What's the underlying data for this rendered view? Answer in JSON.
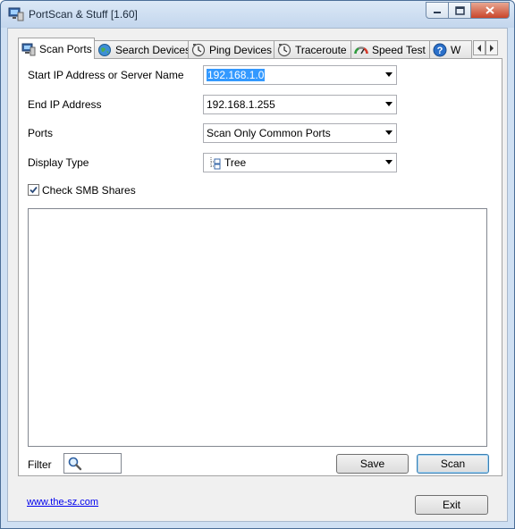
{
  "window": {
    "title": "PortScan & Stuff [1.60]"
  },
  "tabs": [
    {
      "label": "Scan Ports",
      "icon": "computer-icon",
      "active": true
    },
    {
      "label": "Search Devices",
      "icon": "globe-icon"
    },
    {
      "label": "Ping Devices",
      "icon": "clock-icon"
    },
    {
      "label": "Traceroute",
      "icon": "clock-icon"
    },
    {
      "label": "Speed Test",
      "icon": "speedometer-icon"
    },
    {
      "label": "W",
      "icon": "help-icon"
    }
  ],
  "form": {
    "start_ip_label": "Start IP Address or Server Name",
    "start_ip_value": "192.168.1.0",
    "end_ip_label": "End IP Address",
    "end_ip_value": "192.168.1.255",
    "ports_label": "Ports",
    "ports_value": "Scan Only Common Ports",
    "display_type_label": "Display Type",
    "display_type_value": "Tree",
    "smb_label": "Check SMB Shares",
    "smb_checked": true
  },
  "bottom": {
    "filter_label": "Filter",
    "save_label": "Save",
    "scan_label": "Scan"
  },
  "footer": {
    "link_text": "www.the-sz.com",
    "exit_label": "Exit"
  },
  "colors": {
    "title_bar": "#c3d6ed",
    "selection": "#3399ff",
    "close_button": "#c9452a",
    "link": "#0000ee"
  }
}
